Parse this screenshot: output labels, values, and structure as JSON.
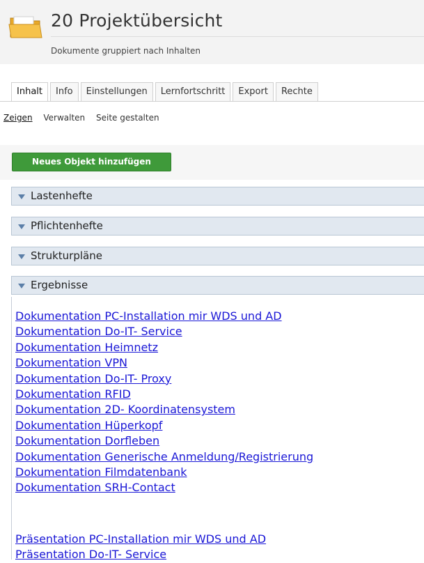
{
  "header": {
    "title": "20 Projektübersicht",
    "subtitle": "Dokumente gruppiert nach Inhalten",
    "icon": "folder-icon"
  },
  "tabs": [
    {
      "label": "Inhalt",
      "active": true
    },
    {
      "label": "Info"
    },
    {
      "label": "Einstellungen"
    },
    {
      "label": "Lernfortschritt"
    },
    {
      "label": "Export"
    },
    {
      "label": "Rechte"
    }
  ],
  "subtabs": [
    {
      "label": "Zeigen",
      "active": true
    },
    {
      "label": "Verwalten"
    },
    {
      "label": "Seite gestalten"
    }
  ],
  "toolbar": {
    "add_label": "Neues Objekt hinzufügen",
    "add_color": "#3f9a3a"
  },
  "blocks": [
    {
      "label": "Lastenhefte"
    },
    {
      "label": "Pflichtenhefte"
    },
    {
      "label": "Strukturpläne"
    },
    {
      "label": "Ergebnisse"
    }
  ],
  "results": {
    "documentation": [
      "Dokumentation PC-Installation mir WDS und AD",
      "Dokumentation Do-IT- Service",
      "Dokumentation Heimnetz",
      "Dokumentation VPN",
      "Dokumentation Do-IT- Proxy",
      "Dokumentation RFID",
      "Dokumentation 2D- Koordinatensystem",
      "Dokumentation Hüperkopf",
      "Dokumentation Dorfleben",
      "Dokumentation Generische Anmeldung/Registrierung",
      "Dokumentation Filmdatenbank",
      "Dokumentation SRH-Contact"
    ],
    "presentations": [
      "Präsentation PC-Installation mir WDS und AD",
      "Präsentation Do-IT- Service"
    ]
  },
  "colors": {
    "link": "#1a17d6",
    "block_bg": "#e1e8f0",
    "block_arrow": "#5b7fa8"
  }
}
